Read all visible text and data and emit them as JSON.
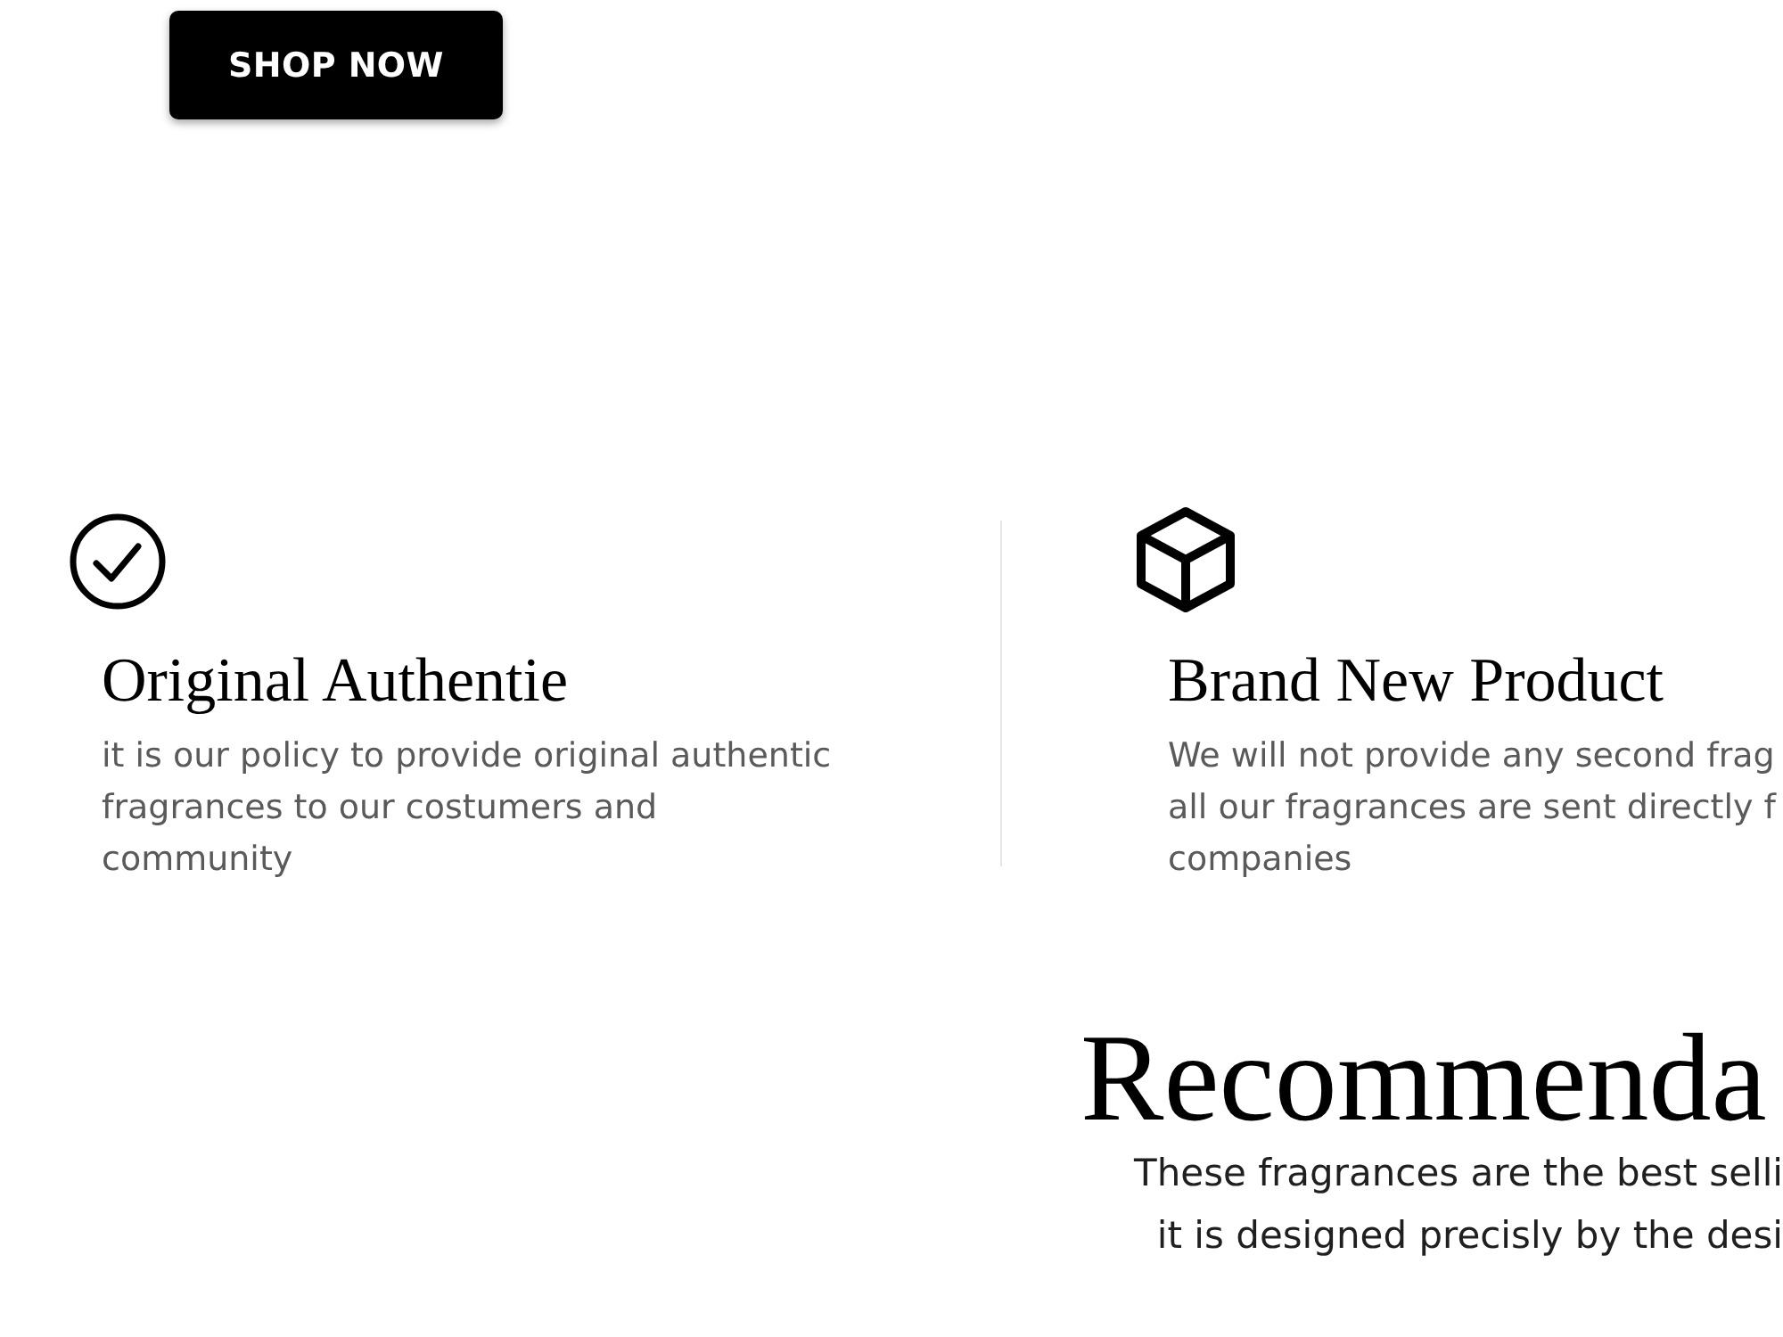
{
  "hero": {
    "button": {
      "label": "SHOP NOW"
    }
  },
  "features": [
    {
      "kind": "check",
      "title": "Original Authentie",
      "lines": [
        "it is our policy to provide original authentic",
        "fragrances to our costumers and",
        "community"
      ]
    },
    {
      "kind": "box",
      "title": "Brand New Product",
      "lines": [
        "We will not provide any second frag",
        "all our fragrances are sent directly f",
        "companies"
      ]
    }
  ],
  "recommendations": {
    "title": "Recommenda",
    "lines": [
      "These fragrances are the best selli",
      "it is designed precisly by the desi"
    ]
  }
}
